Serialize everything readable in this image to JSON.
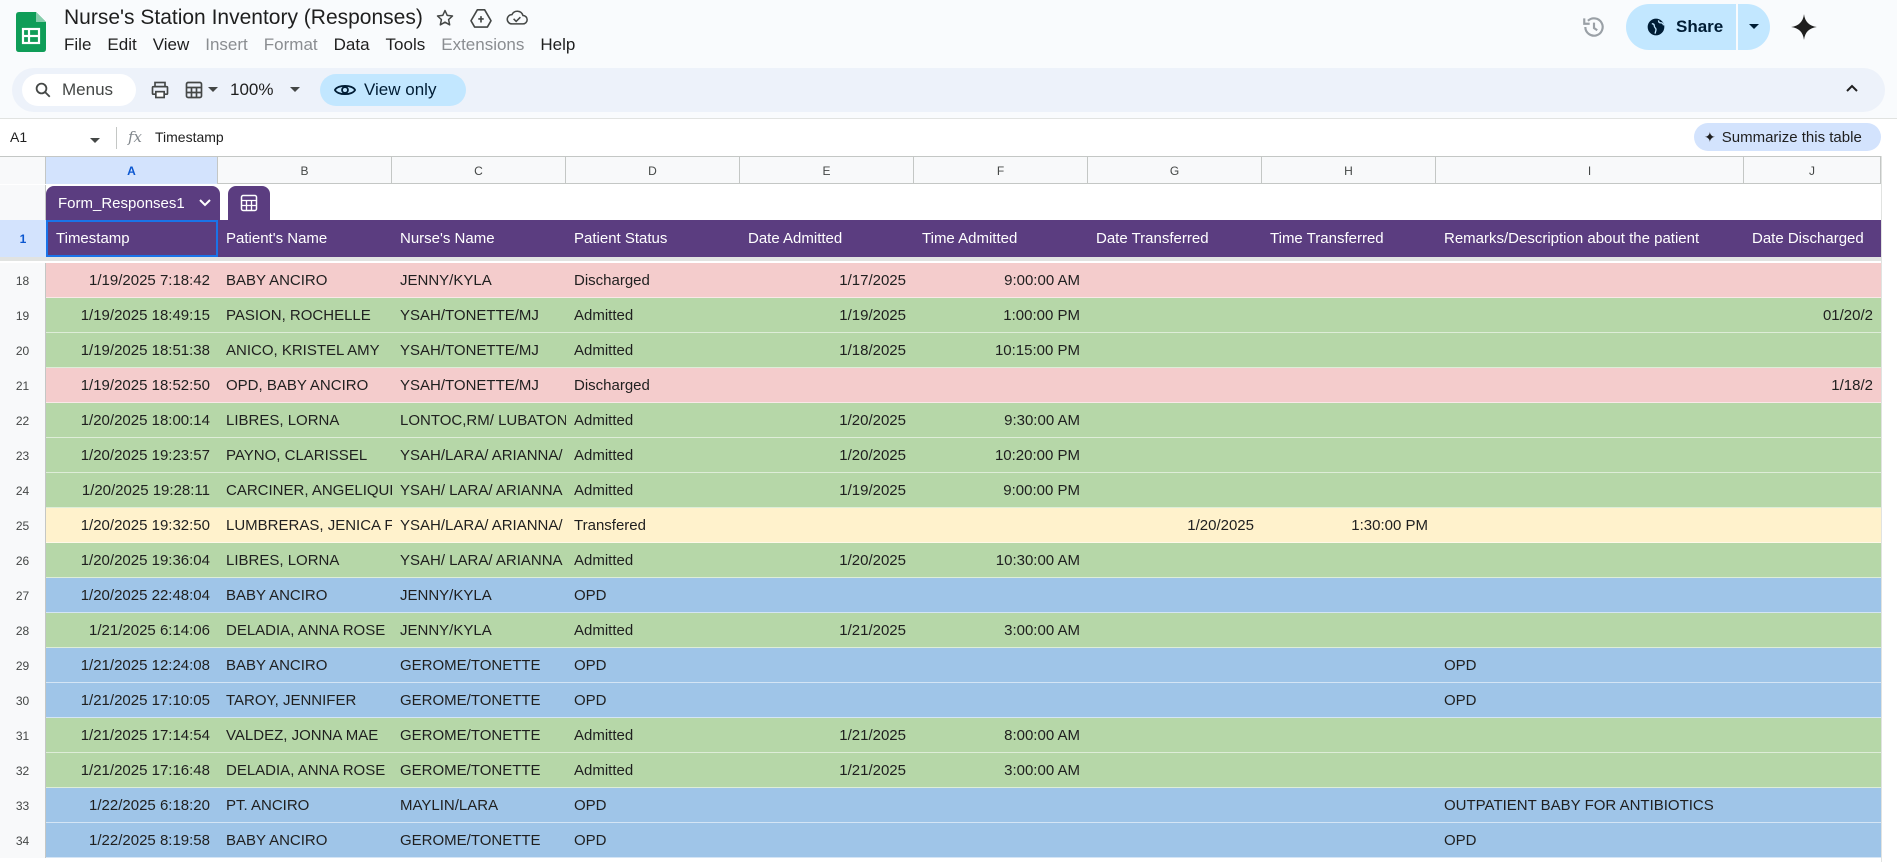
{
  "app": {
    "title": "Nurse's Station Inventory (Responses)",
    "menus": [
      {
        "label": "File",
        "disabled": false
      },
      {
        "label": "Edit",
        "disabled": false
      },
      {
        "label": "View",
        "disabled": false
      },
      {
        "label": "Insert",
        "disabled": true
      },
      {
        "label": "Format",
        "disabled": true
      },
      {
        "label": "Data",
        "disabled": false
      },
      {
        "label": "Tools",
        "disabled": false
      },
      {
        "label": "Extensions",
        "disabled": true
      },
      {
        "label": "Help",
        "disabled": false
      }
    ],
    "share_label": "Share"
  },
  "toolbar": {
    "menus_placeholder": "Menus",
    "zoom": "100%",
    "view_only_label": "View only"
  },
  "formula_bar": {
    "cell_ref": "A1",
    "fx": "fx",
    "content": "Timestamp",
    "summarize_label": "Summarize this table"
  },
  "grid": {
    "column_letters": [
      "A",
      "B",
      "C",
      "D",
      "E",
      "F",
      "G",
      "H",
      "I",
      "J"
    ],
    "table_name": "Form_Responses1",
    "header_row_number": "1",
    "headers": [
      "Timestamp",
      "Patient's Name",
      "Nurse's Name",
      "Patient Status",
      "Date Admitted",
      "Time Admitted",
      "Date Transferred",
      "Time Transferred",
      "Remarks/Description about the patient",
      "Date Discharged"
    ],
    "rows": [
      {
        "num": "18",
        "color": "red",
        "cells": [
          "1/19/2025 7:18:42",
          "BABY ANCIRO",
          "JENNY/KYLA",
          "Discharged",
          "1/17/2025",
          "9:00:00 AM",
          "",
          "",
          "",
          ""
        ]
      },
      {
        "num": "19",
        "color": "green",
        "cells": [
          "1/19/2025 18:49:15",
          "PASION, ROCHELLE",
          "YSAH/TONETTE/MJ",
          "Admitted",
          "1/19/2025",
          "1:00:00 PM",
          "",
          "",
          "",
          "01/20/2"
        ]
      },
      {
        "num": "20",
        "color": "green",
        "cells": [
          "1/19/2025 18:51:38",
          "ANICO, KRISTEL AMY",
          "YSAH/TONETTE/MJ",
          "Admitted",
          "1/18/2025",
          "10:15:00 PM",
          "",
          "",
          "",
          ""
        ]
      },
      {
        "num": "21",
        "color": "red",
        "cells": [
          "1/19/2025 18:52:50",
          "OPD, BABY ANCIRO",
          "YSAH/TONETTE/MJ",
          "Discharged",
          "",
          "",
          "",
          "",
          "",
          "1/18/2"
        ]
      },
      {
        "num": "22",
        "color": "green",
        "cells": [
          "1/20/2025 18:00:14",
          "LIBRES, LORNA",
          "LONTOC,RM/ LUBATON,",
          "Admitted",
          "1/20/2025",
          "9:30:00 AM",
          "",
          "",
          "",
          ""
        ]
      },
      {
        "num": "23",
        "color": "green",
        "cells": [
          "1/20/2025 19:23:57",
          "PAYNO, CLARISSEL",
          "YSAH/LARA/ ARIANNA/",
          "Admitted",
          "1/20/2025",
          "10:20:00 PM",
          "",
          "",
          "",
          ""
        ]
      },
      {
        "num": "24",
        "color": "green",
        "cells": [
          "1/20/2025 19:28:11",
          "CARCINER, ANGELIQUE",
          "YSAH/ LARA/ ARIANNA",
          "Admitted",
          "1/19/2025",
          "9:00:00 PM",
          "",
          "",
          "",
          ""
        ]
      },
      {
        "num": "25",
        "color": "yellow",
        "cells": [
          "1/20/2025 19:32:50",
          "LUMBRERAS, JENICA FA",
          "YSAH/LARA/ ARIANNA/",
          "Transfered",
          "",
          "",
          "1/20/2025",
          "1:30:00 PM",
          "",
          ""
        ]
      },
      {
        "num": "26",
        "color": "green",
        "cells": [
          "1/20/2025 19:36:04",
          "LIBRES, LORNA",
          "YSAH/ LARA/ ARIANNA",
          "Admitted",
          "1/20/2025",
          "10:30:00 AM",
          "",
          "",
          "",
          ""
        ]
      },
      {
        "num": "27",
        "color": "blue",
        "cells": [
          "1/20/2025 22:48:04",
          "BABY ANCIRO",
          "JENNY/KYLA",
          "OPD",
          "",
          "",
          "",
          "",
          "",
          ""
        ]
      },
      {
        "num": "28",
        "color": "green",
        "cells": [
          "1/21/2025 6:14:06",
          "DELADIA, ANNA ROSE",
          "JENNY/KYLA",
          "Admitted",
          "1/21/2025",
          "3:00:00 AM",
          "",
          "",
          "",
          ""
        ]
      },
      {
        "num": "29",
        "color": "blue",
        "cells": [
          "1/21/2025 12:24:08",
          "BABY ANCIRO",
          "GEROME/TONETTE",
          " OPD",
          "",
          "",
          "",
          "",
          "OPD",
          ""
        ]
      },
      {
        "num": "30",
        "color": "blue",
        "cells": [
          "1/21/2025 17:10:05",
          "TAROY, JENNIFER",
          "GEROME/TONETTE",
          "OPD",
          "",
          "",
          "",
          "",
          "OPD",
          ""
        ]
      },
      {
        "num": "31",
        "color": "green",
        "cells": [
          "1/21/2025 17:14:54",
          "VALDEZ, JONNA MAE",
          "GEROME/TONETTE",
          "Admitted",
          "1/21/2025",
          "8:00:00 AM",
          "",
          "",
          "",
          ""
        ]
      },
      {
        "num": "32",
        "color": "green",
        "cells": [
          "1/21/2025 17:16:48",
          "DELADIA, ANNA ROSE",
          "GEROME/TONETTE",
          "Admitted",
          "1/21/2025",
          "3:00:00 AM",
          "",
          "",
          "",
          ""
        ]
      },
      {
        "num": "33",
        "color": "blue",
        "cells": [
          "1/22/2025 6:18:20",
          "PT. ANCIRO",
          "MAYLIN/LARA",
          "OPD",
          "",
          "",
          "",
          "",
          "OUTPATIENT BABY FOR ANTIBIOTICS",
          ""
        ]
      },
      {
        "num": "34",
        "color": "blue",
        "cells": [
          "1/22/2025 8:19:58",
          "BABY ANCIRO",
          "GEROME/TONETTE",
          "OPD",
          "",
          "",
          "",
          "",
          "OPD",
          ""
        ]
      }
    ]
  }
}
